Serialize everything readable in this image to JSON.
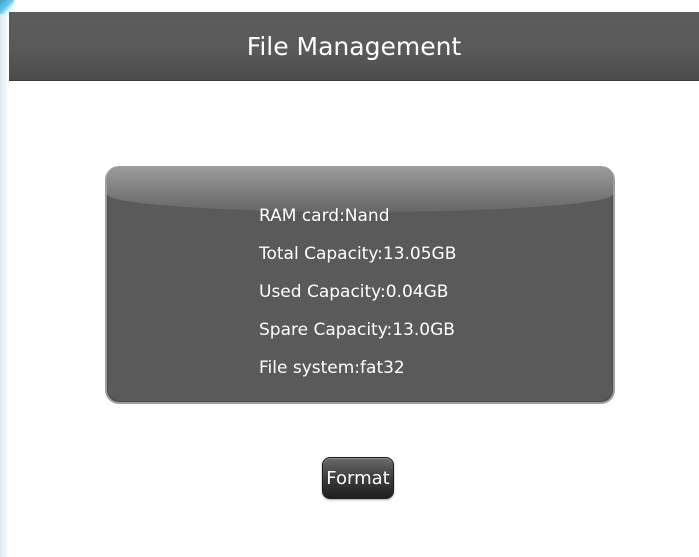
{
  "screen": {
    "title": "File Management"
  },
  "storage_info": {
    "lines": [
      "RAM card:Nand",
      "Total Capacity:13.05GB",
      "Used Capacity:0.04GB",
      "Spare Capacity:13.0GB",
      "File system:fat32"
    ]
  },
  "actions": {
    "format_label": "Format"
  },
  "colors": {
    "title_bar": "#5a5a5a",
    "panel_background": "#5a5a5a",
    "panel_border": "#9e9e9e",
    "text": "#ffffff",
    "page_background": "#ffffff"
  }
}
